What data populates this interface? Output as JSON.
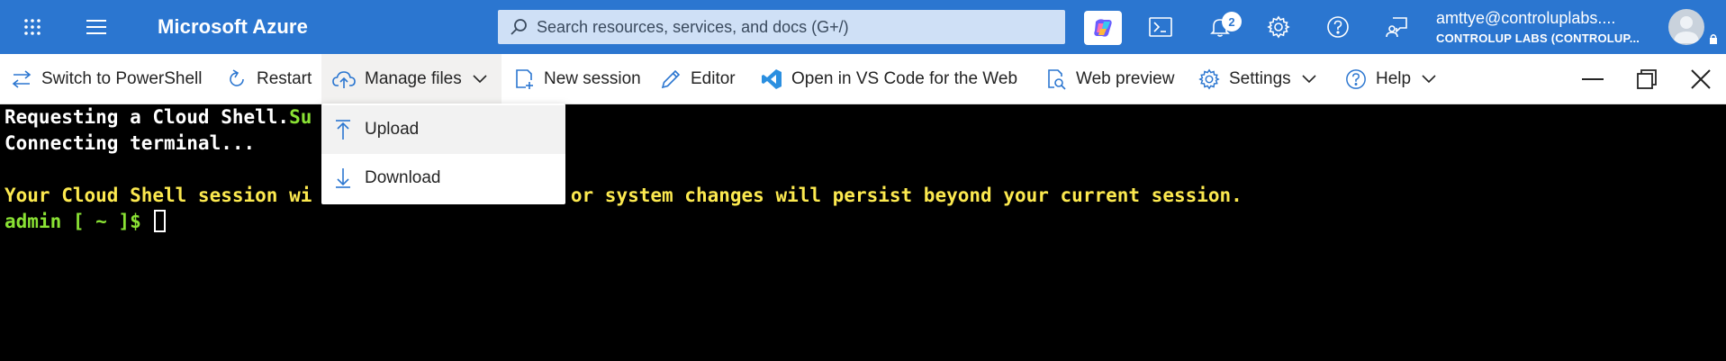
{
  "topbar": {
    "brand": "Microsoft Azure",
    "search_placeholder": "Search resources, services, and docs (G+/)",
    "notifications_count": "2",
    "account_email": "amttye@controluplabs....",
    "account_tenant": "CONTROLUP LABS (CONTROLUP...",
    "icons": [
      "apps-grid-icon",
      "hamburger-menu-icon",
      "search-icon",
      "copilot-icon",
      "cloud-shell-icon",
      "bell-icon",
      "settings-gear-icon",
      "help-icon",
      "feedback-icon"
    ]
  },
  "toolbar": {
    "switch_label": "Switch to PowerShell",
    "restart_label": "Restart",
    "manage_files_label": "Manage files",
    "new_session_label": "New session",
    "editor_label": "Editor",
    "vscode_label": "Open in VS Code for the Web",
    "web_preview_label": "Web preview",
    "settings_label": "Settings",
    "help_label": "Help"
  },
  "dropdown": {
    "items": [
      {
        "label": "Upload",
        "icon": "upload-arrow-icon"
      },
      {
        "label": "Download",
        "icon": "download-arrow-icon"
      }
    ]
  },
  "terminal": {
    "line1_prefix": "Requesting a Cloud Shell.",
    "line1_green": "Su",
    "line2": "Connecting terminal...",
    "line3_a": "Your Cloud Shell session wi",
    "line3_b": " files or system changes will persist beyond your current session.",
    "prompt": "admin [ ~ ]$ "
  },
  "colors": {
    "topbar_bg": "#2b76d0",
    "terminal_bg": "#000000",
    "green": "#8ae234",
    "yellow": "#fce94f"
  }
}
